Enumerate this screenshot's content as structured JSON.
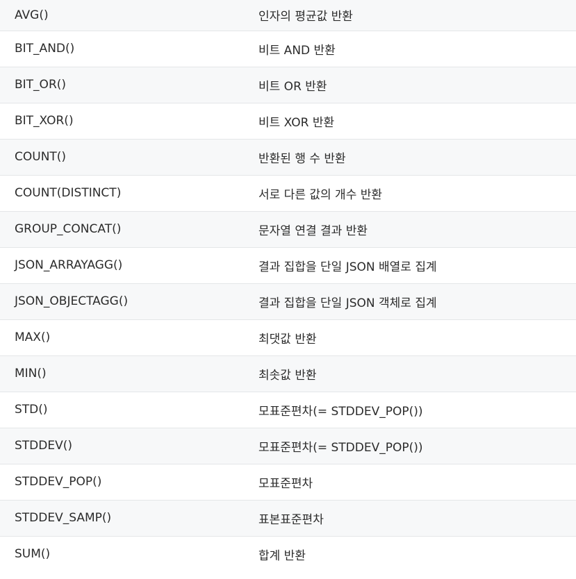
{
  "rows": [
    {
      "name": "AVG()",
      "description": "인자의 평균값 반환"
    },
    {
      "name": "BIT_AND()",
      "description": "비트 AND 반환"
    },
    {
      "name": "BIT_OR()",
      "description": "비트 OR 반환"
    },
    {
      "name": "BIT_XOR()",
      "description": "비트 XOR 반환"
    },
    {
      "name": "COUNT()",
      "description": "반환된 행 수 반환"
    },
    {
      "name": "COUNT(DISTINCT)",
      "description": "서로 다른 값의 개수 반환"
    },
    {
      "name": "GROUP_CONCAT()",
      "description": "문자열 연결 결과 반환"
    },
    {
      "name": "JSON_ARRAYAGG()",
      "description": "결과 집합을 단일 JSON 배열로 집계"
    },
    {
      "name": "JSON_OBJECTAGG()",
      "description": "결과 집합을 단일 JSON 객체로 집계"
    },
    {
      "name": "MAX()",
      "description": "최댓값 반환"
    },
    {
      "name": "MIN()",
      "description": "최솟값 반환"
    },
    {
      "name": "STD()",
      "description": "모표준편차(= STDDEV_POP())"
    },
    {
      "name": "STDDEV()",
      "description": "모표준편차(= STDDEV_POP())"
    },
    {
      "name": "STDDEV_POP()",
      "description": "모표준편차"
    },
    {
      "name": "STDDEV_SAMP()",
      "description": "표본표준편차"
    },
    {
      "name": "SUM()",
      "description": "합계 반환"
    }
  ]
}
